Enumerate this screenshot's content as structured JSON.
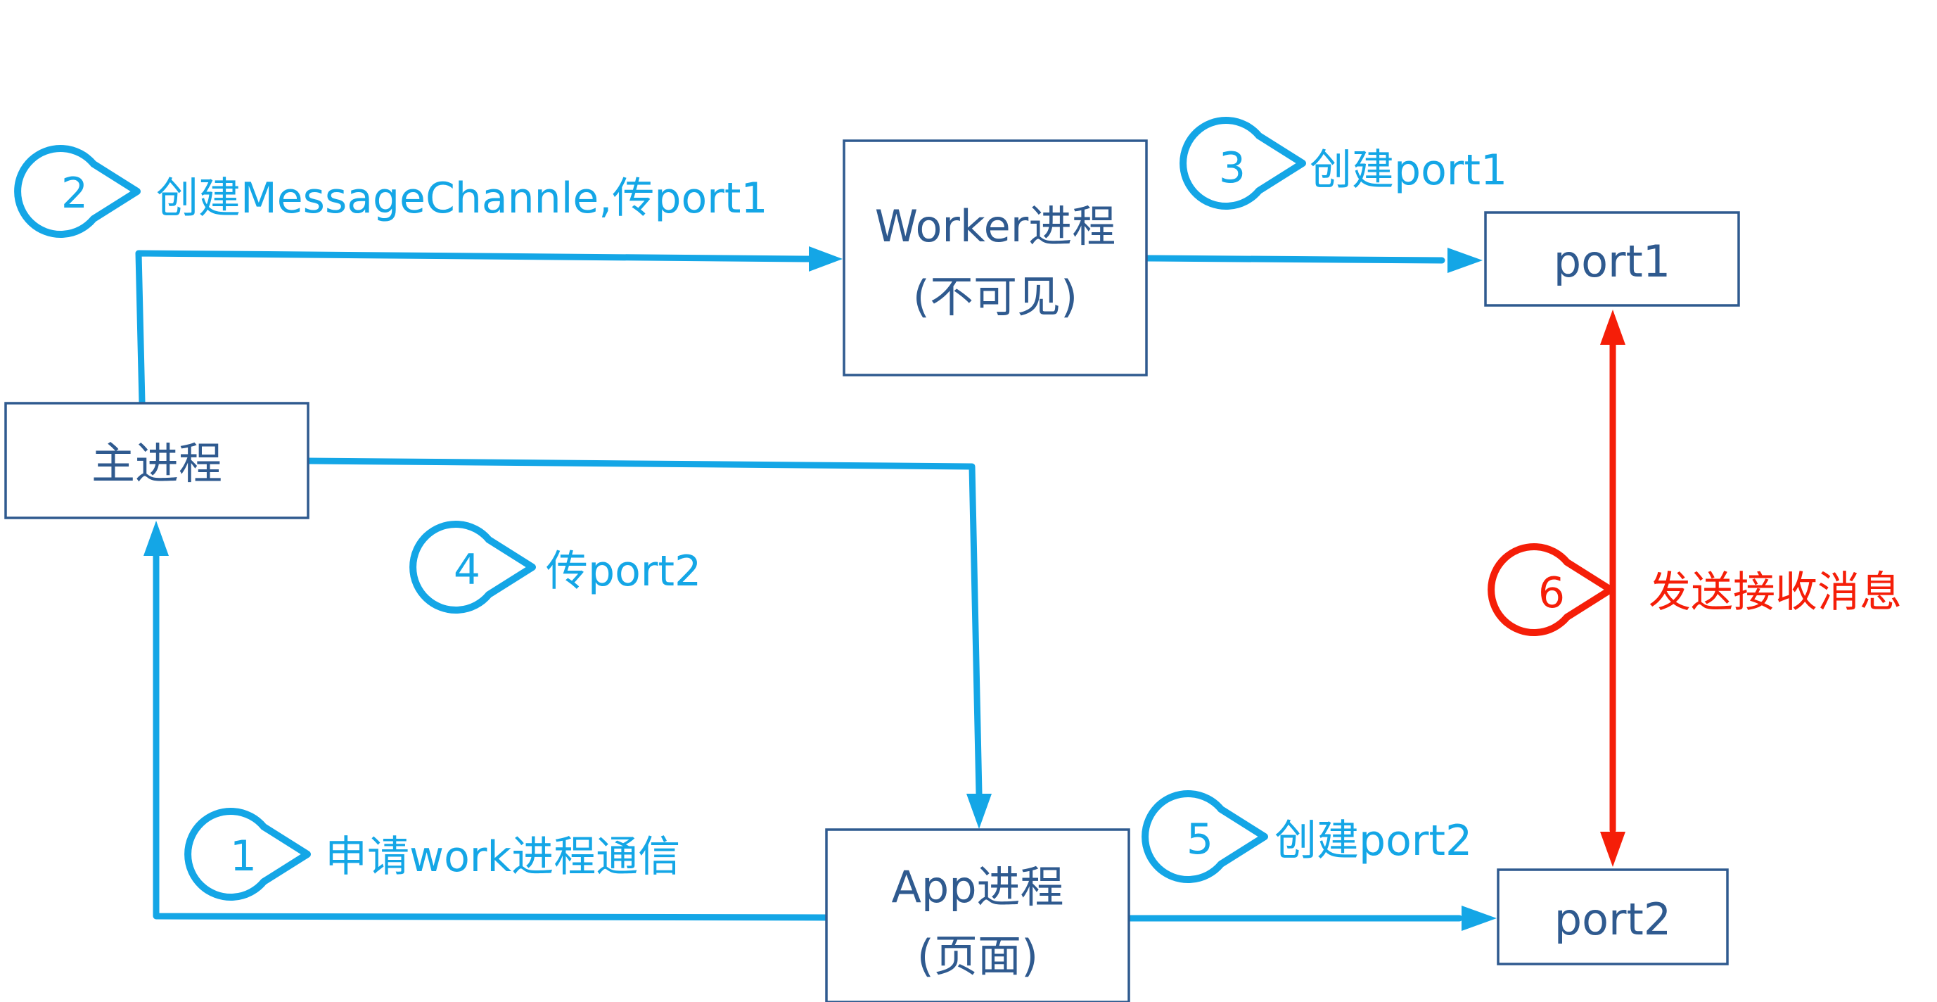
{
  "nodes": {
    "main_process": {
      "label": "主进程"
    },
    "worker_process": {
      "line1": "Worker进程",
      "line2": "(不可见)"
    },
    "app_process": {
      "line1": "App进程",
      "line2": "(页面)"
    },
    "port1": {
      "label": "port1"
    },
    "port2": {
      "label": "port2"
    }
  },
  "steps": [
    {
      "number": "1",
      "label": "申请work进程通信"
    },
    {
      "number": "2",
      "label": "创建MessageChannle,传port1"
    },
    {
      "number": "3",
      "label": "创建port1"
    },
    {
      "number": "4",
      "label": "传port2"
    },
    {
      "number": "5",
      "label": "创建port2"
    },
    {
      "number": "6",
      "label": "发送接收消息"
    }
  ],
  "colors": {
    "box_border": "#2f5a8f",
    "flow": "#14a6e6",
    "messaging": "#f51e08"
  }
}
